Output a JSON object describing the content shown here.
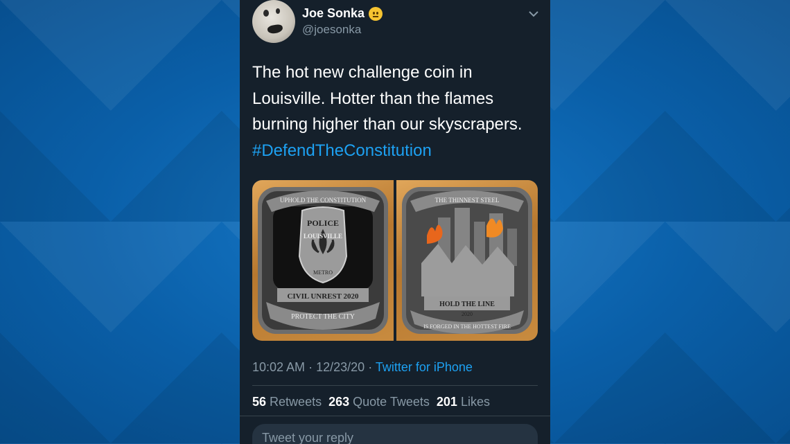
{
  "tweet": {
    "display_name": "Joe Sonka",
    "handle": "@joesonka",
    "text_line1": "The hot new challenge coin in",
    "text_line2": "Louisville. Hotter than the flames",
    "text_line3": "burning higher than our skyscrapers.",
    "hashtag": "#DefendTheConstitution",
    "time": "10:02 AM",
    "date": "12/23/20",
    "source": "Twitter for iPhone",
    "retweets_count": "56",
    "retweets_label": "Retweets",
    "quote_count": "263",
    "quote_label": "Quote Tweets",
    "likes_count": "201",
    "likes_label": "Likes",
    "reply_placeholder": "Tweet your reply"
  },
  "coin_left": {
    "top_text": "UPHOLD THE CONSTITUTION",
    "badge_top": "POLICE",
    "badge_mid": "LOUISVILLE",
    "badge_bottom": "METRO",
    "ribbon": "CIVIL UNREST 2020",
    "bottom_text": "PROTECT THE CITY"
  },
  "coin_right": {
    "top_text": "THE THINNEST STEEL",
    "ribbon": "HOLD THE LINE",
    "year": "2020",
    "bottom_text": "IS FORGED IN THE HOTTEST FIRE"
  },
  "colors": {
    "panel": "#15202b",
    "link": "#1da1f2",
    "muted": "#8899a6",
    "background": "#0a5fa8"
  }
}
